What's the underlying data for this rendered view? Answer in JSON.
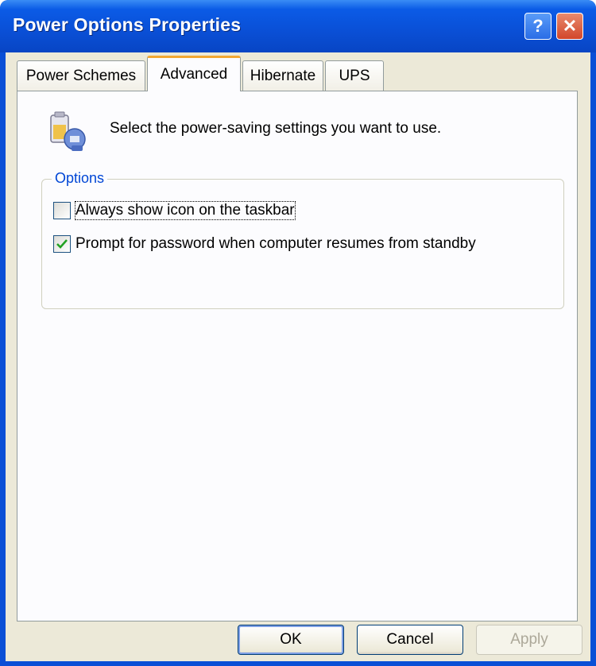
{
  "window": {
    "title": "Power Options Properties",
    "help_glyph": "?",
    "close_glyph": "✕"
  },
  "tabs": [
    {
      "label": "Power Schemes",
      "active": false
    },
    {
      "label": "Advanced",
      "active": true
    },
    {
      "label": "Hibernate",
      "active": false
    },
    {
      "label": "UPS",
      "active": false
    }
  ],
  "panel": {
    "header_icon": "power-settings-icon",
    "header_text": "Select the power-saving settings you want to use.",
    "options": {
      "label": "Options",
      "items": [
        {
          "label": "Always show icon on the taskbar",
          "checked": false
        },
        {
          "label": "Prompt for password when computer resumes from standby",
          "checked": true
        }
      ]
    }
  },
  "buttons": {
    "ok": "OK",
    "cancel": "Cancel",
    "apply": "Apply"
  },
  "colors": {
    "titlebar": "#0a4fd6",
    "active_tab_accent": "#f2a734",
    "group_label": "#0046d5"
  }
}
